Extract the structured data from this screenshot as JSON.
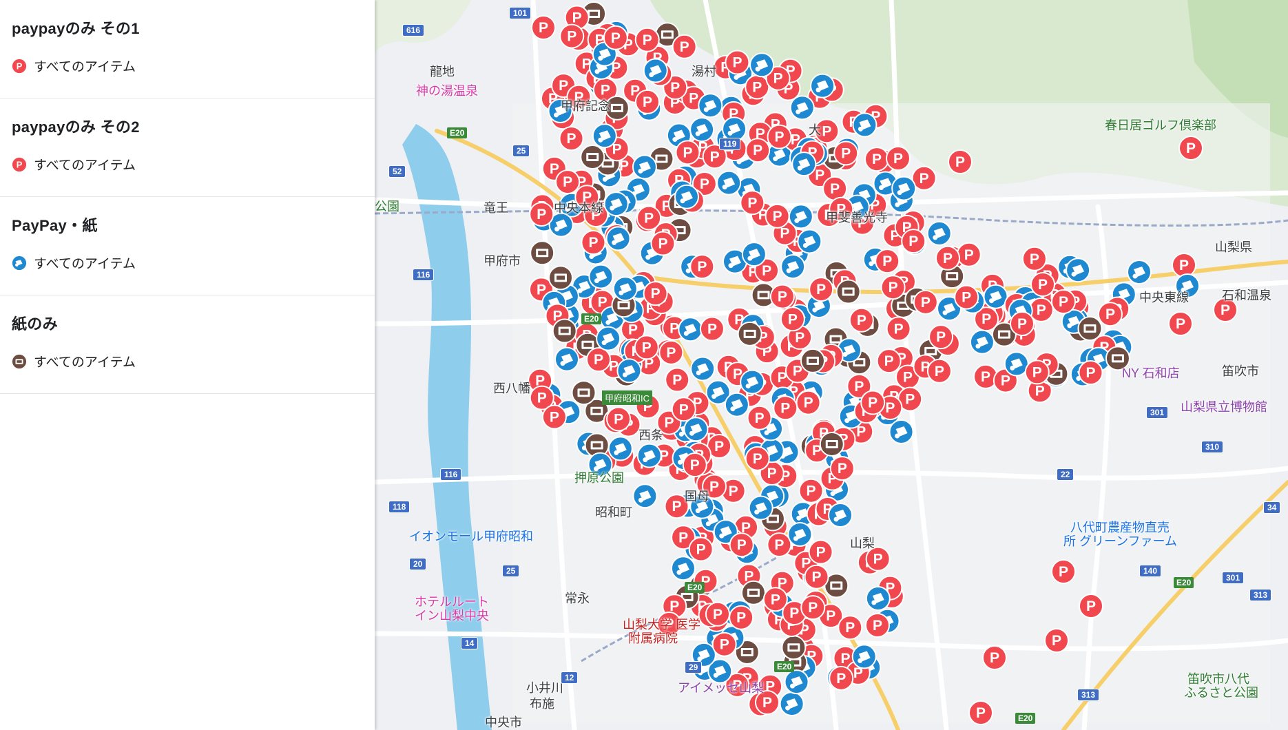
{
  "layers": [
    {
      "title": "paypayのみ その1",
      "item_label": "すべてのアイテム",
      "icon": "paypay-p-icon",
      "color": "#f0484e"
    },
    {
      "title": "paypayのみ その2",
      "item_label": "すべてのアイテム",
      "icon": "paypay-p-icon",
      "color": "#f0484e"
    },
    {
      "title": "PayPay・紙",
      "item_label": "すべてのアイテム",
      "icon": "coupon-ticket-icon",
      "color": "#1e88d0"
    },
    {
      "title": "紙のみ",
      "item_label": "すべてのアイテム",
      "icon": "paper-ticket-icon",
      "color": "#6d4c41"
    }
  ],
  "map": {
    "places": [
      "龍地",
      "湯村",
      "甲府記念",
      "甲府市",
      "竜王",
      "中央本線",
      "甲斐善光寺",
      "山梨県",
      "石和温泉",
      "中央東線",
      "笛吹市",
      "西八幡",
      "西条",
      "昭和町",
      "常永",
      "小井川",
      "布施",
      "中央市",
      "国母",
      "山梨",
      "大"
    ],
    "pois": [
      "神の湯温泉",
      "春日居ゴルフ倶楽部",
      "押原公園",
      "イオンモール甲府昭和",
      "ホテルルート",
      "イン山梨中央",
      "山梨大学 医学",
      "附属病院",
      "アイメッセ山梨",
      "八代町農産物直売",
      "所 グリーンファーム",
      "山梨県立博物館",
      "笛吹市八代",
      "ふるさと公園",
      "NY 石和店",
      "甲府昭和IC",
      "公園"
    ],
    "routes": [
      "101",
      "616",
      "25",
      "52",
      "116",
      "20",
      "119",
      "116",
      "118",
      "25",
      "12",
      "29",
      "313",
      "301",
      "310",
      "22",
      "140",
      "301",
      "313",
      "34",
      "14"
    ],
    "expressway": [
      "E20",
      "E20",
      "E20",
      "E20",
      "E20",
      "E20"
    ],
    "colors": {
      "paypay": "#f0484e",
      "paypay_paper": "#1e88d0",
      "paper": "#6d4c41",
      "river": "#8fcdec",
      "park": "#c9e6c4",
      "road": "#ffffff"
    }
  }
}
